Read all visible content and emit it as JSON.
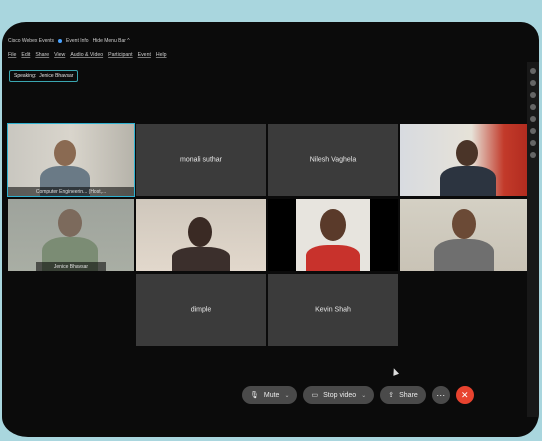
{
  "titlebar": {
    "app": "Cisco Webex Events",
    "event_info": "Event Info",
    "hide_menu": "Hide Menu Bar ^"
  },
  "menu": [
    "File",
    "Edit",
    "Share",
    "View",
    "Audio & Video",
    "Participant",
    "Event",
    "Help"
  ],
  "speaking": {
    "label": "Speaking:",
    "name": "Jenice Bhavsar"
  },
  "tiles": {
    "t1": {
      "caption": "Computer Engineerin... (Host,..."
    },
    "t2": {
      "name": "monali suthar"
    },
    "t3": {
      "name": "Nilesh Vaghela"
    },
    "t5": {
      "caption": "Jenice Bhavsar"
    },
    "t10": {
      "name": "dimple"
    },
    "t11": {
      "name": "Kevin Shah"
    }
  },
  "toolbar": {
    "mute": "Mute",
    "stop_video": "Stop video",
    "share": "Share",
    "more": "···",
    "leave": "✕"
  }
}
